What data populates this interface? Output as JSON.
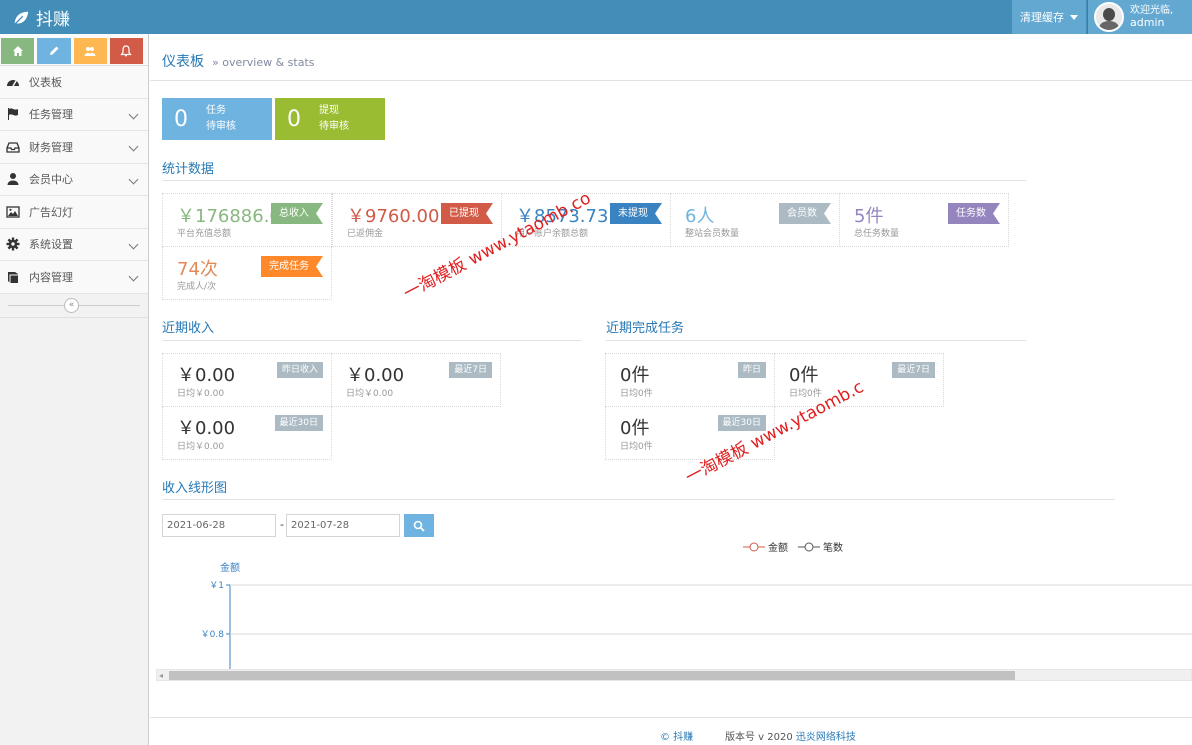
{
  "navbar": {
    "brand": "抖赚",
    "clear_cache": "清理缓存",
    "welcome": "欢迎光临,",
    "username": "admin"
  },
  "sidebar": {
    "items": [
      {
        "label": "仪表板",
        "icon": "dashboard-icon"
      },
      {
        "label": "任务管理",
        "icon": "flag-icon"
      },
      {
        "label": "财务管理",
        "icon": "inbox-icon"
      },
      {
        "label": "会员中心",
        "icon": "user-icon"
      },
      {
        "label": "广告幻灯",
        "icon": "picture-icon"
      },
      {
        "label": "系统设置",
        "icon": "gear-icon"
      },
      {
        "label": "内容管理",
        "icon": "book-icon"
      }
    ]
  },
  "breadcrumb": {
    "title": "仪表板",
    "subtitle": "» overview & stats"
  },
  "infoboxes": [
    {
      "count": "0",
      "line1": "任务",
      "line2": "待审核"
    },
    {
      "count": "0",
      "line1": "提现",
      "line2": "待审核"
    }
  ],
  "stats_title": "统计数据",
  "stats": [
    {
      "value": "￥176886.0",
      "label": "平台充值总额",
      "tag": "总收入",
      "color": "#87b87f"
    },
    {
      "value": "￥9760.00",
      "label": "已返佣金",
      "tag": "已提现",
      "color": "#d15b47"
    },
    {
      "value": "￥8573.73",
      "label": "用户账户余额总额",
      "tag": "未提现",
      "color": "#3983c2"
    },
    {
      "value": "6人",
      "label": "整站会员数量",
      "tag": "会员数",
      "color": "#6fb3e0"
    },
    {
      "value": "5件",
      "label": "总任务数量",
      "tag": "任务数",
      "color": "#9585bf"
    },
    {
      "value": "74次",
      "label": "完成人/次",
      "tag": "完成任务",
      "color": "#e08a57"
    }
  ],
  "income_title": "近期收入",
  "income": [
    {
      "value": "￥0.00",
      "label": "日均￥0.00",
      "tag": "昨日收入"
    },
    {
      "value": "￥0.00",
      "label": "日均￥0.00",
      "tag": "最近7日"
    },
    {
      "value": "￥0.00",
      "label": "日均￥0.00",
      "tag": "最近30日"
    }
  ],
  "tasks_title": "近期完成任务",
  "tasks": [
    {
      "value": "0件",
      "label": "日均0件",
      "tag": "昨日"
    },
    {
      "value": "0件",
      "label": "日均0件",
      "tag": "最近7日"
    },
    {
      "value": "0件",
      "label": "日均0件",
      "tag": "最近30日"
    }
  ],
  "chart_section_title": "收入线形图",
  "date_from": "2021-06-28",
  "date_to": "2021-07-28",
  "chart_data": {
    "type": "line",
    "title": "",
    "ylabel": "金额",
    "y_ticks": [
      "￥1",
      "￥0.8"
    ],
    "ylim": [
      0.8,
      1
    ],
    "series": [
      {
        "name": "金额",
        "values": [],
        "color": "#d15b47"
      },
      {
        "name": "笔数",
        "values": [],
        "color": "#555555"
      }
    ],
    "legend_position": "top-center",
    "grid": true
  },
  "footer": {
    "copyright": "© 抖赚",
    "version": "版本号 v 2020",
    "company": "迅炎网络科技"
  },
  "watermarks": [
    "一淘模板 www.ytaomb.co",
    "一淘模板 www.ytaomb.c"
  ]
}
